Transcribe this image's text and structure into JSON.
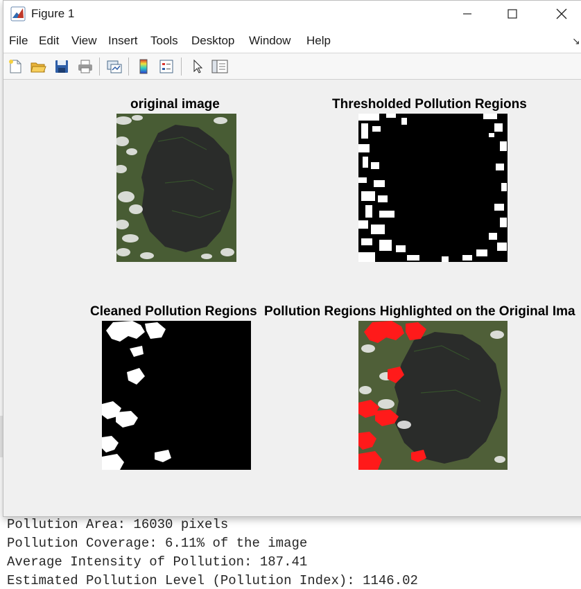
{
  "window": {
    "title": "Figure 1",
    "controls": [
      "minimize",
      "maximize",
      "close"
    ]
  },
  "menu": {
    "items": [
      "File",
      "Edit",
      "View",
      "Insert",
      "Tools",
      "Desktop",
      "Window",
      "Help"
    ]
  },
  "toolbar": {
    "buttons": [
      "new-figure-icon",
      "open-file-icon",
      "save-icon",
      "print-icon",
      "link-plot-icon",
      "insert-colorbar-icon",
      "insert-legend-icon",
      "edit-plot-icon",
      "property-inspector-icon"
    ]
  },
  "axes": [
    {
      "title": "original image"
    },
    {
      "title": "Thresholded Pollution Regions"
    },
    {
      "title": "Cleaned Pollution Regions"
    },
    {
      "title": "Pollution Regions Highlighted on the Original Ima"
    }
  ],
  "console": {
    "lines": [
      "Pollution Area: 16030 pixels",
      "Pollution Coverage: 6.11% of the image",
      "Average Intensity of Pollution: 187.41",
      "Estimated Pollution Level (Pollution Index): 1146.02"
    ]
  },
  "colors": {
    "highlight": "#ff1a1a",
    "mask_foreground": "#ffffff",
    "mask_background": "#000000",
    "lake": "#2a2c2a",
    "land": "#4e5e38"
  }
}
